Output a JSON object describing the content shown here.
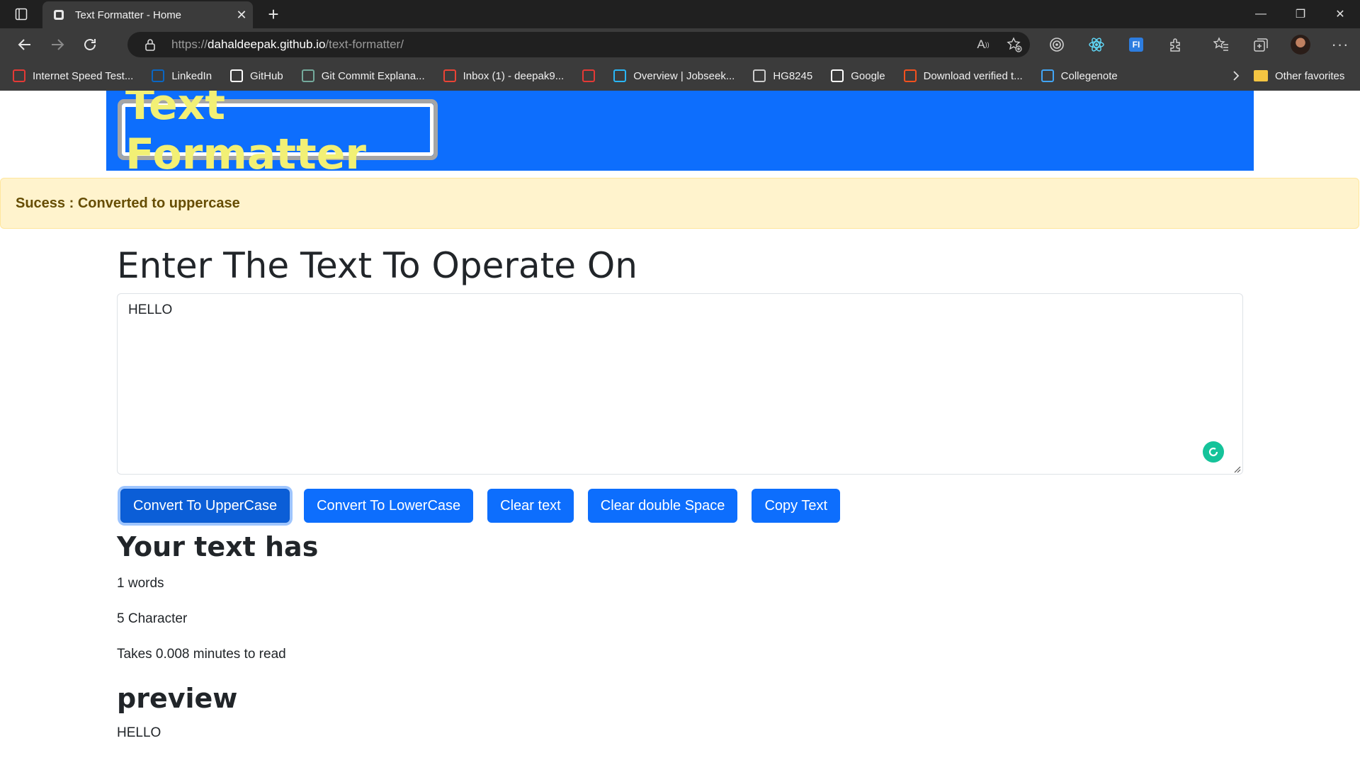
{
  "browser": {
    "tab_title": "Text Formatter - Home",
    "tab_close": "✕",
    "new_tab": "+",
    "url_scheme": "https://",
    "url_host": "dahaldeepak.github.io",
    "url_path": "/text-formatter/",
    "window_controls": {
      "minimize": "—",
      "restore": "❐",
      "close": "✕"
    }
  },
  "bookmarks": [
    {
      "label": "Internet Speed Test...",
      "icon": "speedometer-icon",
      "color": "#e53935"
    },
    {
      "label": "LinkedIn",
      "icon": "linkedin-icon",
      "color": "#0a66c2"
    },
    {
      "label": "GitHub",
      "icon": "github-icon",
      "color": "#ffffff"
    },
    {
      "label": "Git Commit Explana...",
      "icon": "chatgpt-icon",
      "color": "#74aa9c"
    },
    {
      "label": "Inbox (1) - deepak9...",
      "icon": "gmail-icon",
      "color": "#ea4335"
    },
    {
      "label": "",
      "icon": "pdf-icon",
      "color": "#e53935"
    },
    {
      "label": "Overview | Jobseek...",
      "icon": "jobseeker-icon",
      "color": "#29b6f6"
    },
    {
      "label": "HG8245",
      "icon": "document-icon",
      "color": "#cccccc"
    },
    {
      "label": "Google",
      "icon": "google-icon",
      "color": "#ffffff"
    },
    {
      "label": "Download verified t...",
      "icon": "x-icon",
      "color": "#f4511e"
    },
    {
      "label": "Collegenote",
      "icon": "college-icon",
      "color": "#42a5f5"
    }
  ],
  "bookmarks_other": "Other favorites",
  "page": {
    "brand": "Text Formatter",
    "alert": {
      "type": "Sucess",
      "separator": " : ",
      "message": "Converted to uppercase"
    },
    "heading": "Enter The Text To Operate On",
    "textarea_value": "HELLO",
    "buttons": {
      "upper": "Convert To UpperCase",
      "lower": "Convert To LowerCase",
      "clear": "Clear text",
      "clear_space": "Clear double Space",
      "copy": "Copy Text"
    },
    "summary_title": "Your text has",
    "word_count": "1 words",
    "char_count": "5 Character",
    "read_time": "Takes 0.008 minutes to read",
    "preview_title": "preview",
    "preview_text": "HELLO"
  },
  "colors": {
    "primary": "#0d6efd",
    "brand_text": "#f2f075",
    "alert_bg": "#fff3cd",
    "alert_text": "#664d03"
  }
}
